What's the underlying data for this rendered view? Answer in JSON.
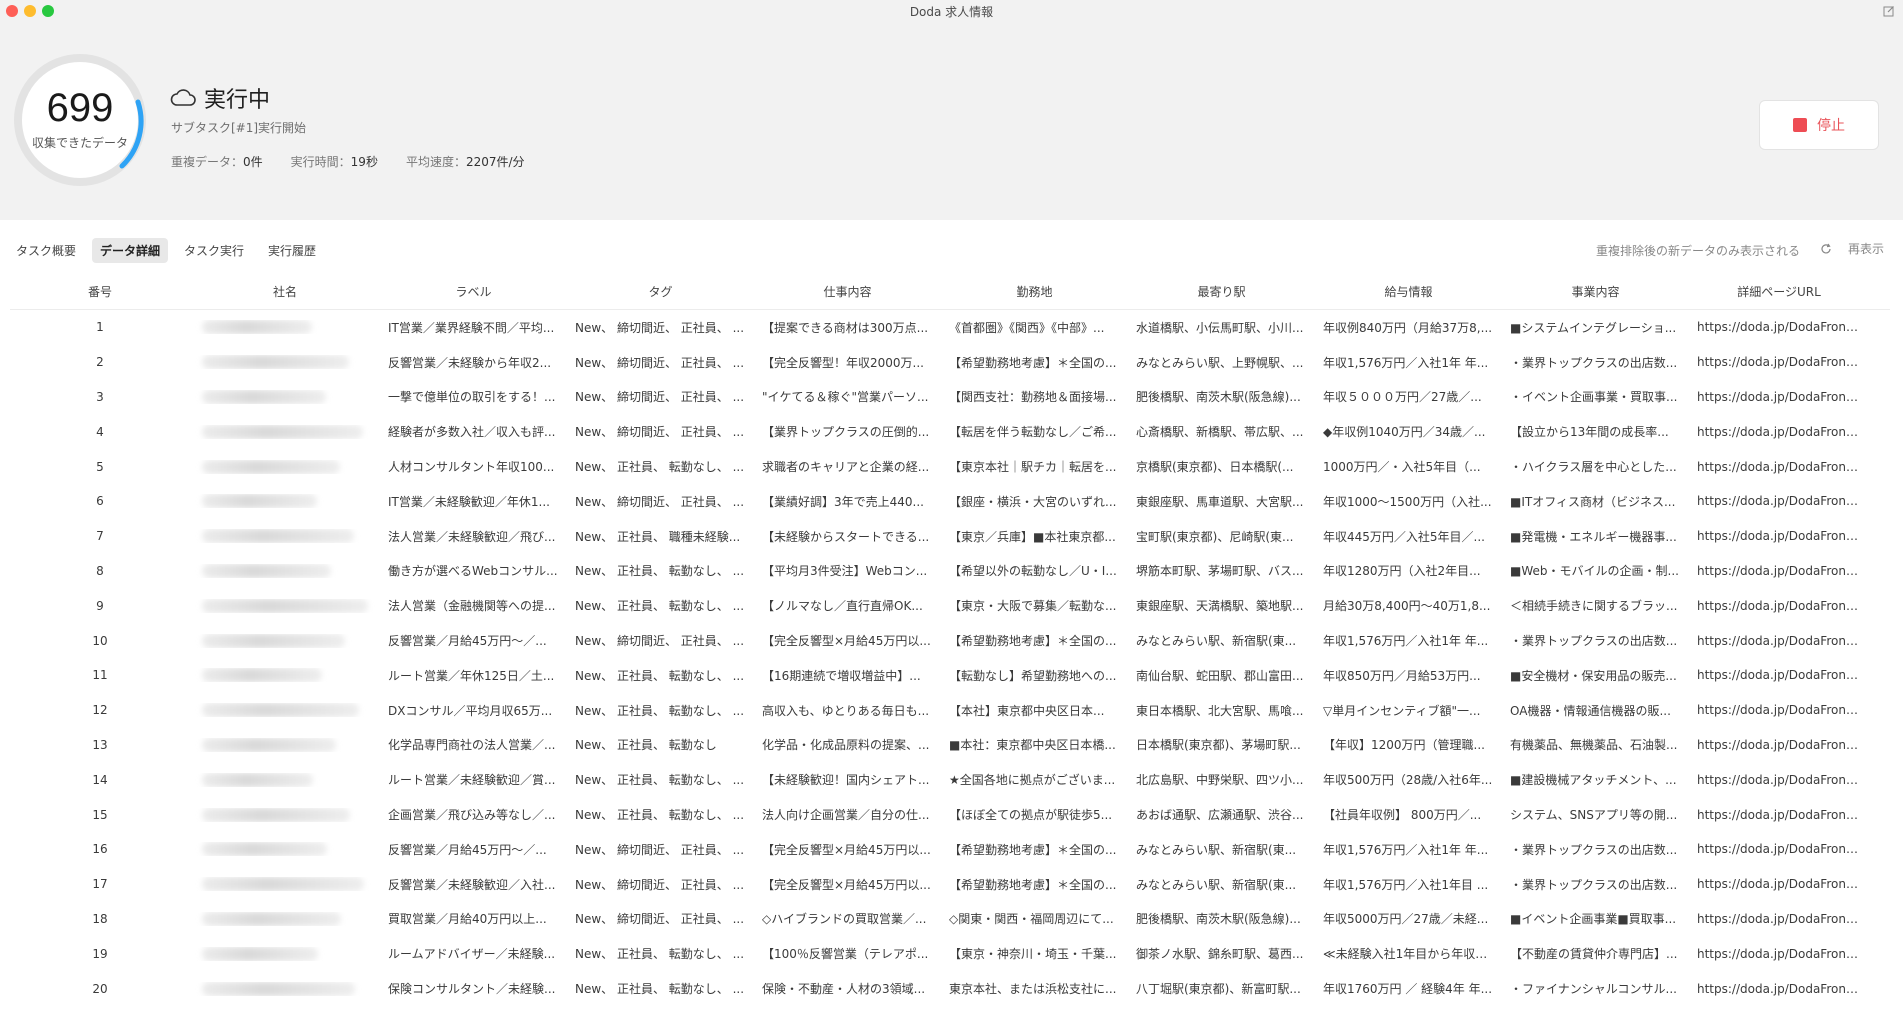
{
  "window": {
    "title": "Doda 求人情報"
  },
  "progress": {
    "count": "699",
    "label": "収集できたデータ"
  },
  "status": {
    "text": "実行中",
    "subtask": "サブタスク[#1]実行開始",
    "dup_label": "重複データ：",
    "dup_value": "0件",
    "time_label": "実行時間：",
    "time_value": "19秒",
    "speed_label": "平均速度：",
    "speed_value": "2207件/分"
  },
  "stop_button": {
    "label": "停止"
  },
  "tabs": [
    {
      "label": "タスク概要"
    },
    {
      "label": "データ詳細"
    },
    {
      "label": "タスク実行"
    },
    {
      "label": "実行履歴"
    }
  ],
  "notice": "重複排除後の新データのみ表示される",
  "refresh_label": "再表示",
  "columns": [
    "番号",
    "社名",
    "ラベル",
    "タグ",
    "仕事内容",
    "勤務地",
    "最寄り駅",
    "給与情報",
    "事業内容",
    "詳細ページURL"
  ],
  "rows": [
    {
      "num": "1",
      "label": "IT営業／業界経験不問／平均...",
      "tag": "New、 締切間近、 正社員、 ...",
      "job": "【提案できる商材は300万点...",
      "loc": "《首都圏》《関西》《中部》...",
      "st": "水道橋駅、小伝馬町駅、小川...",
      "sal": "年収例840万円（月給37万8,...",
      "biz": "■システムインテグレーショ...",
      "url": "https://doda.jp/DodaFront/..."
    },
    {
      "num": "2",
      "label": "反響営業／未経験から年収2...",
      "tag": "New、 締切間近、 正社員、 ...",
      "job": "【完全反響型！年収2000万...",
      "loc": "【希望勤務地考慮】＊全国の...",
      "st": "みなとみらい駅、上野幌駅、...",
      "sal": "年収1,576万円／入社1年 年...",
      "biz": "・業界トップクラスの出店数...",
      "url": "https://doda.jp/DodaFront/..."
    },
    {
      "num": "3",
      "label": "一撃で億単位の取引をする！...",
      "tag": "New、 締切間近、 正社員、 ...",
      "job": "\"イケてる＆稼ぐ\"営業パーソ...",
      "loc": "【関西支社：勤務地＆面接場...",
      "st": "肥後橋駅、南茨木駅(阪急線)...",
      "sal": "年収５０００万円／27歳／...",
      "biz": "・イベント企画事業・買取事...",
      "url": "https://doda.jp/DodaFront/..."
    },
    {
      "num": "4",
      "label": "経験者が多数入社／収入も評...",
      "tag": "New、 締切間近、 正社員、 ...",
      "job": "【業界トップクラスの圧倒的...",
      "loc": "【転居を伴う転勤なし／ご希...",
      "st": "心斎橋駅、新橋駅、帯広駅、...",
      "sal": "◆年収例1040万円／34歳／...",
      "biz": "【設立から13年間の成長率...",
      "url": "https://doda.jp/DodaFront/..."
    },
    {
      "num": "5",
      "label": "人材コンサルタント年収100...",
      "tag": "New、 正社員、 転勤なし、 ...",
      "job": "求職者のキャリアと企業の経...",
      "loc": "【東京本社｜駅チカ｜転居を...",
      "st": "京橋駅(東京都)、日本橋駅(...",
      "sal": "1000万円／・入社5年目（...",
      "biz": "・ハイクラス層を中心とした...",
      "url": "https://doda.jp/DodaFront/..."
    },
    {
      "num": "6",
      "label": "IT営業／未経験歓迎／年休1...",
      "tag": "New、 締切間近、 正社員、 ...",
      "job": "【業績好調】3年で売上440...",
      "loc": "【銀座・横浜・大宮のいずれ...",
      "st": "東銀座駅、馬車道駅、大宮駅...",
      "sal": "年収1000〜1500万円（入社...",
      "biz": "■ITオフィス商材（ビジネス...",
      "url": "https://doda.jp/DodaFront/..."
    },
    {
      "num": "7",
      "label": "法人営業／未経験歓迎／飛び...",
      "tag": "New、 正社員、 職種未経験...",
      "job": "【未経験からスタートできる...",
      "loc": "【東京／兵庫】■本社東京都...",
      "st": "宝町駅(東京都)、尼崎駅(東...",
      "sal": "年収445万円／入社5年目／...",
      "biz": "■発電機・エネルギー機器事...",
      "url": "https://doda.jp/DodaFront/..."
    },
    {
      "num": "8",
      "label": "働き方が選べるWebコンサル...",
      "tag": "New、 正社員、 転勤なし、 ...",
      "job": "【平均月3件受注】Webコン...",
      "loc": "【希望以外の転勤なし／U・I...",
      "st": "堺筋本町駅、茅場町駅、バス...",
      "sal": "年収1280万円（入社2年目...",
      "biz": "■Web・モバイルの企画・制...",
      "url": "https://doda.jp/DodaFront/..."
    },
    {
      "num": "9",
      "label": "法人営業（金融機関等への提...",
      "tag": "New、 正社員、 転勤なし、 ...",
      "job": "【ノルマなし／直行直帰OK...",
      "loc": "【東京・大阪で募集／転勤な...",
      "st": "東銀座駅、天満橋駅、築地駅...",
      "sal": "月給30万8,400円〜40万1,8...",
      "biz": "＜相続手続きに関するブラッ...",
      "url": "https://doda.jp/DodaFront/..."
    },
    {
      "num": "10",
      "label": "反響営業／月給45万円〜／...",
      "tag": "New、 締切間近、 正社員、 ...",
      "job": "【完全反響型×月給45万円以...",
      "loc": "【希望勤務地考慮】＊全国の...",
      "st": "みなとみらい駅、新宿駅(東...",
      "sal": "年収1,576万円／入社1年 年...",
      "biz": "・業界トップクラスの出店数...",
      "url": "https://doda.jp/DodaFront/..."
    },
    {
      "num": "11",
      "label": "ルート営業／年休125日／土...",
      "tag": "New、 正社員、 転勤なし、 ...",
      "job": "【16期連続で増収増益中】...",
      "loc": "【転勤なし】希望勤務地への...",
      "st": "南仙台駅、蛇田駅、郡山富田...",
      "sal": "年収850万円／月給53万円...",
      "biz": "■安全機材・保安用品の販売...",
      "url": "https://doda.jp/DodaFront/..."
    },
    {
      "num": "12",
      "label": "DXコンサル／平均月収65万...",
      "tag": "New、 正社員、 転勤なし、 ...",
      "job": "高収入も、ゆとりある毎日も...",
      "loc": "【本社】東京都中央区日本...",
      "st": "東日本橋駅、北大宮駅、馬喰...",
      "sal": "▽単月インセンティブ額\"一...",
      "biz": "OA機器・情報通信機器の販...",
      "url": "https://doda.jp/DodaFront/..."
    },
    {
      "num": "13",
      "label": "化学品専門商社の法人営業／...",
      "tag": "New、 正社員、 転勤なし",
      "job": "化学品・化成品原料の提案、...",
      "loc": "■本社：東京都中央区日本橋...",
      "st": "日本橋駅(東京都)、茅場町駅...",
      "sal": "【年収】1200万円（管理職...",
      "biz": "有機薬品、無機薬品、石油製...",
      "url": "https://doda.jp/DodaFront/..."
    },
    {
      "num": "14",
      "label": "ルート営業／未経験歓迎／賞...",
      "tag": "New、 正社員、 転勤なし、 ...",
      "job": "【未経験歓迎！国内シェアト...",
      "loc": "★全国各地に拠点がございま...",
      "st": "北広島駅、中野栄駅、四ツ小...",
      "sal": "年収500万円（28歳/入社6年...",
      "biz": "■建設機械アタッチメント、...",
      "url": "https://doda.jp/DodaFront/..."
    },
    {
      "num": "15",
      "label": "企画営業／飛び込み等なし／...",
      "tag": "New、 正社員、 転勤なし、 ...",
      "job": "法人向け企画営業／自分の仕...",
      "loc": "【ほぼ全ての拠点が駅徒歩5...",
      "st": "あおば通駅、広瀬通駅、渋谷...",
      "sal": "【社員年収例】 800万円／...",
      "biz": "システム、SNSアプリ等の開...",
      "url": "https://doda.jp/DodaFront/..."
    },
    {
      "num": "16",
      "label": "反響営業／月給45万円〜／...",
      "tag": "New、 締切間近、 正社員、 ...",
      "job": "【完全反響型×月給45万円以...",
      "loc": "【希望勤務地考慮】＊全国の...",
      "st": "みなとみらい駅、新宿駅(東...",
      "sal": "年収1,576万円／入社1年 年...",
      "biz": "・業界トップクラスの出店数...",
      "url": "https://doda.jp/DodaFront/..."
    },
    {
      "num": "17",
      "label": "反響営業／未経験歓迎／入社...",
      "tag": "New、 締切間近、 正社員、 ...",
      "job": "【完全反響型×月給45万円以...",
      "loc": "【希望勤務地考慮】＊全国の...",
      "st": "みなとみらい駅、新宿駅(東...",
      "sal": "年収1,576万円／入社1年目 ...",
      "biz": "・業界トップクラスの出店数...",
      "url": "https://doda.jp/DodaFront/..."
    },
    {
      "num": "18",
      "label": "買取営業／月給40万円以上...",
      "tag": "New、 締切間近、 正社員、 ...",
      "job": "◇ハイブランドの買取営業／...",
      "loc": "◇関東・関西・福岡周辺にて...",
      "st": "肥後橋駅、南茨木駅(阪急線)...",
      "sal": "年収5000万円／27歳／未経...",
      "biz": "■イベント企画事業■買取事...",
      "url": "https://doda.jp/DodaFront/..."
    },
    {
      "num": "19",
      "label": "ルームアドバイザー／未経験...",
      "tag": "New、 正社員、 転勤なし、 ...",
      "job": "【100％反響営業（テレアポ...",
      "loc": "【東京・神奈川・埼玉・千葉...",
      "st": "御茶ノ水駅、錦糸町駅、葛西...",
      "sal": "≪未経験入社1年目から年収7...",
      "biz": "【不動産の賃貸仲介専門店】...",
      "url": "https://doda.jp/DodaFront/..."
    },
    {
      "num": "20",
      "label": "保険コンサルタント／未経験...",
      "tag": "New、 正社員、 転勤なし、 ...",
      "job": "保険・不動産・人材の3領域...",
      "loc": "東京本社、または浜松支社に...",
      "st": "八丁堀駅(東京都)、新富町駅...",
      "sal": "年収1760万円 ／ 経験4年 年...",
      "biz": "・ファイナンシャルコンサル...",
      "url": "https://doda.jp/DodaFront/..."
    }
  ]
}
